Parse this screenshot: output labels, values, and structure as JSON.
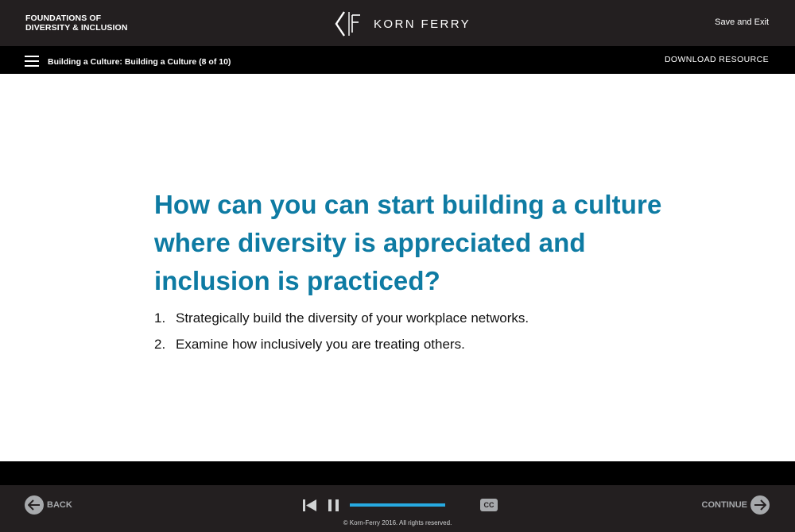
{
  "header": {
    "course_title_line1": "FOUNDATIONS OF",
    "course_title_line2": "DIVERSITY & INCLUSION",
    "logo_text": "KORN FERRY",
    "save_exit_label": "Save and Exit"
  },
  "subheader": {
    "breadcrumb": "Building a Culture: Building a Culture (8 of 10)",
    "download_label": "DOWNLOAD RESOURCE"
  },
  "main": {
    "question": "How can you can start building a culture where diversity is appreciated and inclusion is practiced?",
    "steps": [
      {
        "num": "1.",
        "text": "Strategically build the diversity of your workplace networks."
      },
      {
        "num": "2.",
        "text": "Examine how inclusively you are treating others."
      }
    ]
  },
  "footer": {
    "back_label": "BACK",
    "continue_label": "CONTINUE",
    "cc_label": "CC",
    "progress_fraction": 1.0,
    "copyright": "© Korn-Ferry 2016. All rights reserved."
  },
  "colors": {
    "header_bg": "#231f20",
    "subheader_bg": "#000000",
    "accent_blue": "#0e7ba3",
    "progress_blue": "#27aae1",
    "control_gray": "#a7a9ac"
  },
  "icons": {
    "menu": "hamburger-menu-icon",
    "back": "arrow-left-circle-icon",
    "continue": "arrow-right-circle-icon",
    "restart": "skip-to-start-icon",
    "pause": "pause-icon",
    "captions": "closed-captions-icon"
  }
}
